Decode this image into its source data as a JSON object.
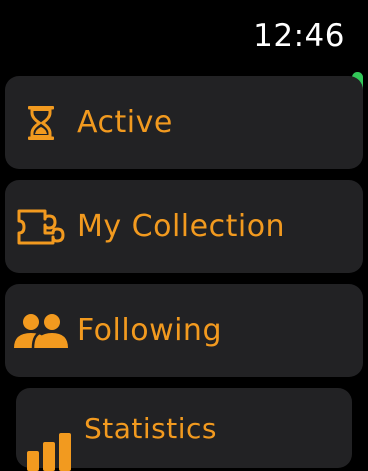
{
  "status": {
    "time": "12:46"
  },
  "menu": {
    "items": [
      {
        "label": "Active",
        "icon": "hourglass-icon"
      },
      {
        "label": "My Collection",
        "icon": "puzzle-icon"
      },
      {
        "label": "Following",
        "icon": "people-icon"
      },
      {
        "label": "Statistics",
        "icon": "bar-chart-icon"
      }
    ]
  },
  "colors": {
    "accent": "#f29a1f",
    "card_background": "#222224",
    "scroll_indicator": "#32c758",
    "clock": "#ffffff"
  },
  "scroll": {
    "position_fraction": 0.0
  }
}
